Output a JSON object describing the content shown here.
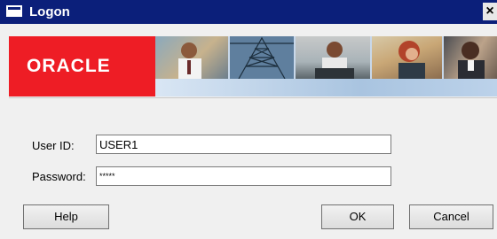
{
  "window": {
    "title": "Logon",
    "close_glyph": "×",
    "app_icon": "window-icon",
    "close_icon": "close-icon",
    "title_bar_color": "#0b1f7a"
  },
  "banner": {
    "logo_text": "ORACLE",
    "logo_color": "#ee1d25",
    "photos": [
      "banner-photo-person-1",
      "banner-photo-tower",
      "banner-photo-person-2",
      "banner-photo-person-3",
      "banner-photo-person-4"
    ]
  },
  "form": {
    "user_id_label": "User ID:",
    "user_id_value": "USER1",
    "password_label": "Password:",
    "password_value": "*****"
  },
  "buttons": {
    "help": "Help",
    "ok": "OK",
    "cancel": "Cancel"
  }
}
